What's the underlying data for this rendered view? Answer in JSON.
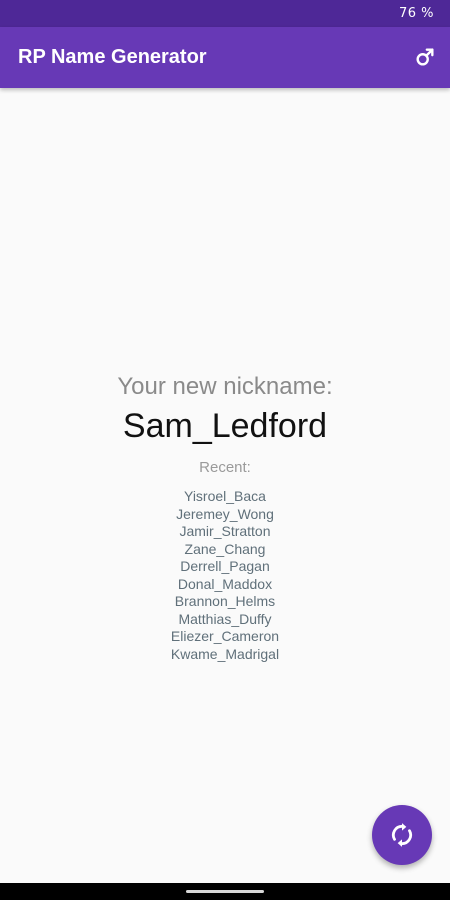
{
  "status_bar": {
    "battery": "76 %"
  },
  "app_bar": {
    "title": "RP Name Generator",
    "gender_icon": "male-symbol-icon"
  },
  "main": {
    "nickname_label": "Your new nickname:",
    "nickname": "Sam_Ledford",
    "recent_label": "Recent:",
    "recent": [
      "Yisroel_Baca",
      "Jeremey_Wong",
      "Jamir_Stratton",
      "Zane_Chang",
      "Derrell_Pagan",
      "Donal_Maddox",
      "Brannon_Helms",
      "Matthias_Duffy",
      "Eliezer_Cameron",
      "Kwame_Madrigal"
    ]
  },
  "fab": {
    "icon": "refresh-icon"
  },
  "colors": {
    "primary": "#6739b6",
    "primary_dark": "#4e2897",
    "background": "#fafafa"
  }
}
